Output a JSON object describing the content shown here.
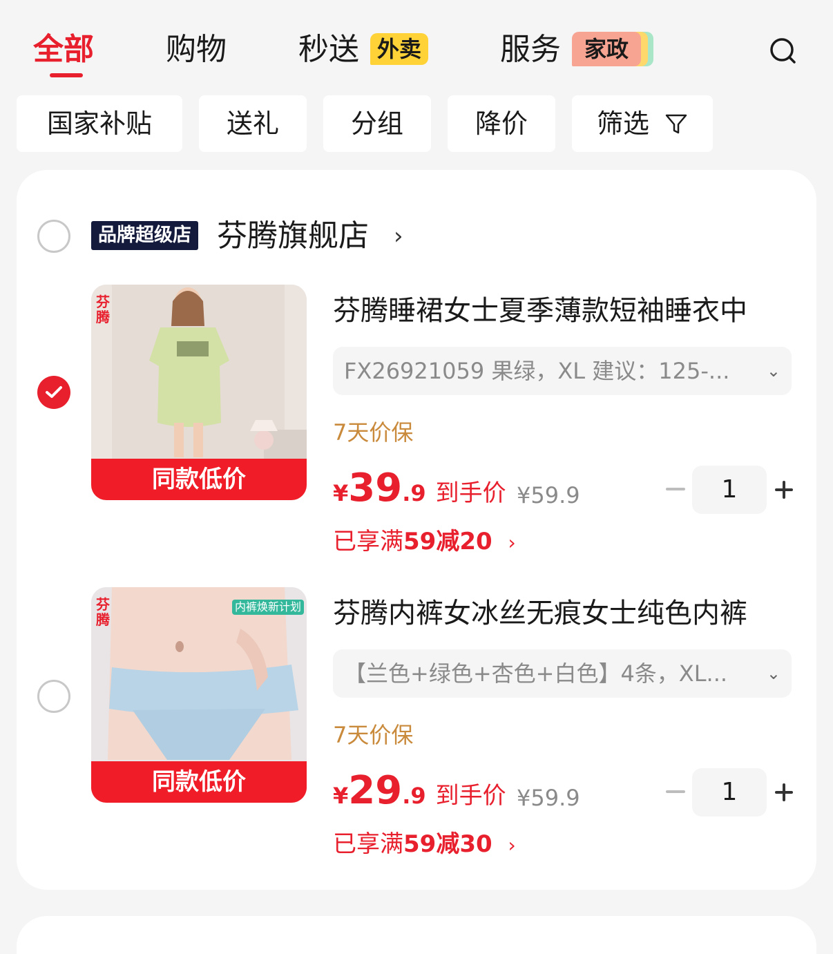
{
  "tabs": [
    {
      "label": "全部",
      "active": true
    },
    {
      "label": "购物"
    },
    {
      "label": "秒送",
      "badge": "外卖"
    },
    {
      "label": "服务",
      "badge": "家政"
    }
  ],
  "filters": [
    "国家补贴",
    "送礼",
    "分组",
    "降价",
    "筛选"
  ],
  "store": {
    "badge": "品牌超级店",
    "name": "芬腾旗舰店"
  },
  "items": [
    {
      "selected": true,
      "brand_mark": "芬腾",
      "image_label": "同款低价",
      "title": "芬腾睡裙女士夏季薄款短袖睡衣中",
      "sku": "FX26921059 果绿，XL 建议：125-...",
      "protection": "7天价保",
      "price": {
        "currency": "¥",
        "integer": "39",
        "decimal": ".9",
        "tip": "到手价"
      },
      "original_price": "¥59.9",
      "promo": {
        "prefix": "已享满",
        "text": "59减20"
      },
      "quantity": "1"
    },
    {
      "selected": false,
      "brand_mark": "芬腾",
      "image_tag": "内裤焕新计划",
      "image_label": "同款低价",
      "title": "芬腾内裤女冰丝无痕女士纯色内裤",
      "sku": "【兰色+绿色+杏色+白色】4条，XL...",
      "protection": "7天价保",
      "price": {
        "currency": "¥",
        "integer": "29",
        "decimal": ".9",
        "tip": "到手价"
      },
      "original_price": "¥59.9",
      "promo": {
        "prefix": "已享满",
        "text": "59减30"
      },
      "quantity": "1"
    }
  ],
  "colors": {
    "accent": "#e8202e",
    "protect": "#c98a3c",
    "store_badge": "#141a3c"
  },
  "icons": [
    "search-icon",
    "filter-funnel-icon",
    "chevron-right-icon",
    "chevron-down-icon",
    "checkmark-icon",
    "minus-icon",
    "plus-icon"
  ]
}
